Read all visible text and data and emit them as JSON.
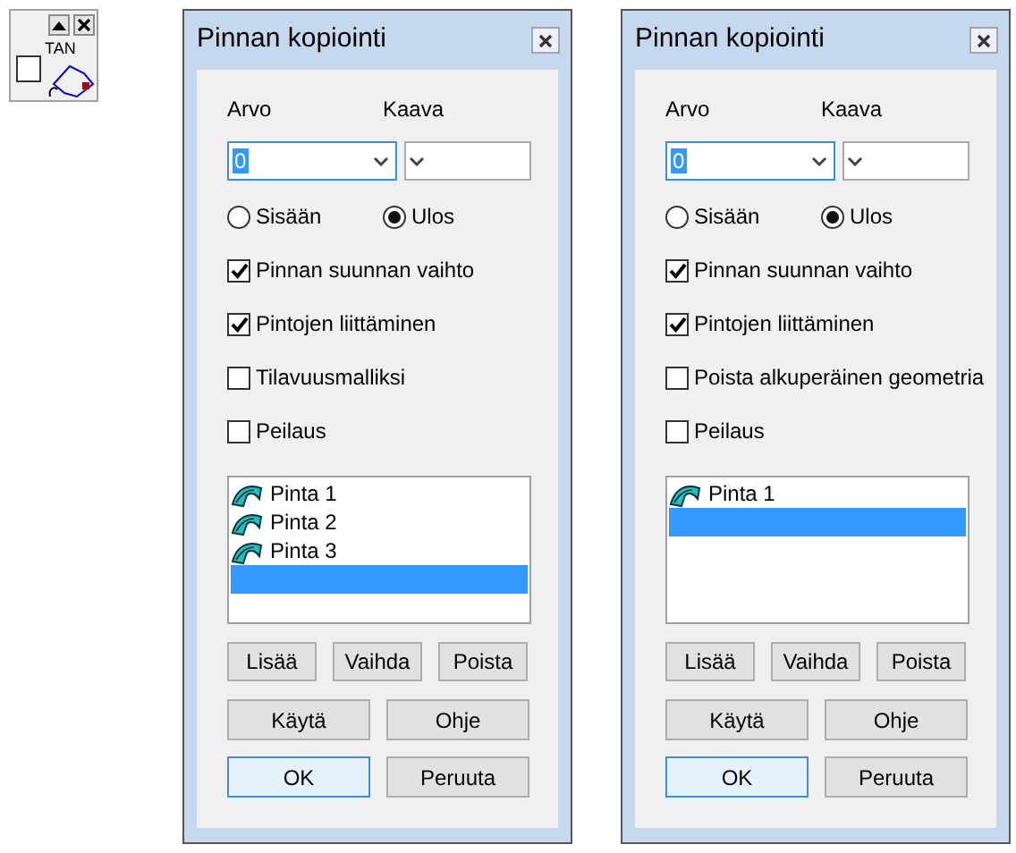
{
  "tool_widget": {
    "label": "TAN",
    "checked": false
  },
  "dialogs": [
    {
      "title": "Pinnan kopiointi",
      "value_label": "Arvo",
      "formula_label": "Kaava",
      "value": "0",
      "value_focused": true,
      "radios": [
        {
          "label": "Sisään",
          "selected": false
        },
        {
          "label": "Ulos",
          "selected": true
        }
      ],
      "checkboxes": [
        {
          "label": "Pinnan suunnan vaihto",
          "checked": true
        },
        {
          "label": "Pintojen liittäminen",
          "checked": true
        },
        {
          "label": "Tilavuusmalliksi",
          "checked": false
        },
        {
          "label": "Peilaus",
          "checked": false
        }
      ],
      "list": {
        "items": [
          {
            "label": "Pinta 1",
            "selected": false
          },
          {
            "label": "Pinta 2",
            "selected": false
          },
          {
            "label": "Pinta 3",
            "selected": false
          }
        ],
        "empty_row_selected": true
      },
      "buttons": [
        {
          "label": "Lisää",
          "focused": false
        },
        {
          "label": "Vaihda",
          "focused": false
        },
        {
          "label": "Poista",
          "focused": false
        },
        {
          "label": "Käytä",
          "focused": false
        },
        {
          "label": "Ohje",
          "focused": false
        },
        {
          "label": "OK",
          "focused": true
        },
        {
          "label": "Peruuta",
          "focused": false
        }
      ]
    },
    {
      "title": "Pinnan kopiointi",
      "value_label": "Arvo",
      "formula_label": "Kaava",
      "value": "0",
      "value_focused": true,
      "radios": [
        {
          "label": "Sisään",
          "selected": false
        },
        {
          "label": "Ulos",
          "selected": true
        }
      ],
      "checkboxes": [
        {
          "label": "Pinnan suunnan vaihto",
          "checked": true
        },
        {
          "label": "Pintojen liittäminen",
          "checked": true
        },
        {
          "label": "Poista alkuperäinen geometria",
          "checked": false
        },
        {
          "label": "Peilaus",
          "checked": false
        }
      ],
      "list": {
        "items": [
          {
            "label": "Pinta 1",
            "selected": false
          }
        ],
        "empty_row_selected": true
      },
      "buttons": [
        {
          "label": "Lisää",
          "focused": false
        },
        {
          "label": "Vaihda",
          "focused": false
        },
        {
          "label": "Poista",
          "focused": false
        },
        {
          "label": "Käytä",
          "focused": false
        },
        {
          "label": "Ohje",
          "focused": false
        },
        {
          "label": "OK",
          "focused": true
        },
        {
          "label": "Peruuta",
          "focused": false
        }
      ]
    }
  ]
}
